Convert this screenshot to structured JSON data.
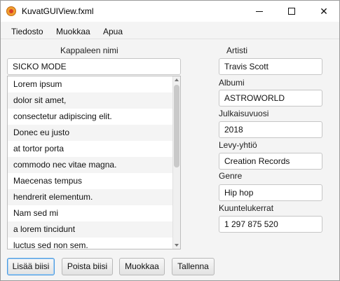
{
  "window": {
    "title": "KuvatGUIView.fxml"
  },
  "menu": [
    "Tiedosto",
    "Muokkaa",
    "Apua"
  ],
  "song": {
    "label": "Kappaleen nimi",
    "value": "SICKO MODE"
  },
  "list_items": [
    "Lorem ipsum",
    "dolor sit amet,",
    "consectetur adipiscing elit.",
    "Donec eu justo",
    "at tortor porta",
    "commodo nec vitae magna.",
    "Maecenas tempus",
    "hendrerit elementum.",
    "Nam sed mi",
    "a lorem tincidunt",
    "luctus sed non sem."
  ],
  "fields": {
    "artist": {
      "label": "Artisti",
      "value": "Travis Scott"
    },
    "album": {
      "label": "Albumi",
      "value": "ASTROWORLD"
    },
    "year": {
      "label": "Julkaisuvuosi",
      "value": "2018"
    },
    "label_company": {
      "label": "Levy-yhtiö",
      "value": "Creation Records"
    },
    "genre": {
      "label": "Genre",
      "value": "Hip hop"
    },
    "plays": {
      "label": "Kuuntelukerrat",
      "value": "1 297 875 520"
    }
  },
  "buttons": {
    "add": "Lisää biisi",
    "remove": "Poista biisi",
    "edit": "Muokkaa",
    "save": "Tallenna"
  }
}
